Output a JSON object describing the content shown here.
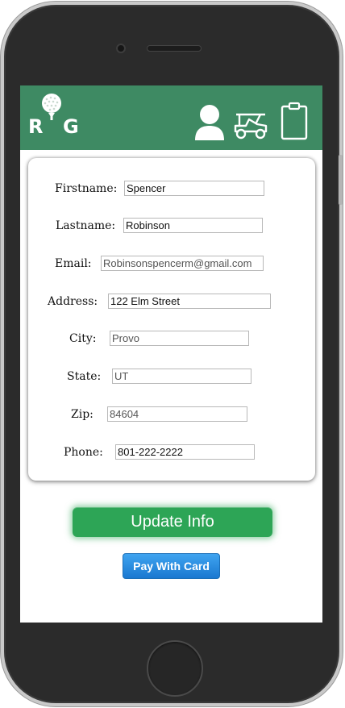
{
  "app": {
    "logo_text_left": "R",
    "logo_text_right": "G",
    "brand_color": "#3e8a63"
  },
  "header": {
    "icons": [
      "user-icon",
      "golf-cart-icon",
      "clipboard-icon"
    ]
  },
  "form": {
    "firstname": {
      "label": "Firstname:",
      "value": "Spencer"
    },
    "lastname": {
      "label": "Lastname:",
      "value": "Robinson"
    },
    "email": {
      "label": "Email:",
      "value": "Robinsonspencerm@gmail.com"
    },
    "address": {
      "label": "Address:",
      "value": "122 Elm Street"
    },
    "city": {
      "label": "City:",
      "value": "Provo"
    },
    "state": {
      "label": "State:",
      "value": "UT"
    },
    "zip": {
      "label": "Zip:",
      "value": "84604"
    },
    "phone": {
      "label": "Phone:",
      "value": "801-222-2222"
    }
  },
  "actions": {
    "update_label": "Update Info",
    "update_color": "#2da556",
    "pay_label": "Pay With Card",
    "pay_color": "#1a78d0"
  }
}
